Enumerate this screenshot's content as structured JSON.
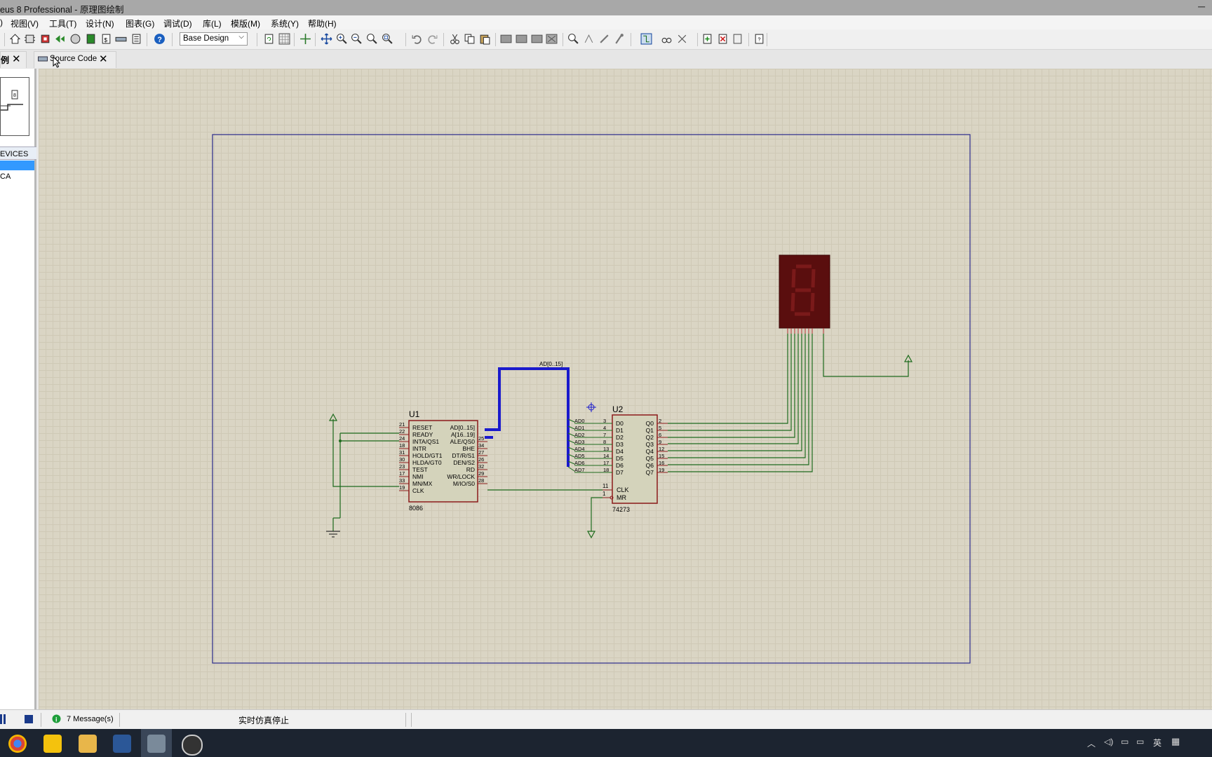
{
  "window": {
    "title": "eus 8 Professional - 原理图绘制"
  },
  "menu": {
    "items": [
      "视图(V)",
      "工具(T)",
      "设计(N)",
      "图表(G)",
      "调试(D)",
      "库(L)",
      "模版(M)",
      "系统(Y)",
      "帮助(H)"
    ]
  },
  "toolbar": {
    "design_select": "Base Design"
  },
  "tabs": {
    "first_label": "例",
    "second_label": "Source Code"
  },
  "left_panel": {
    "devices_header": "EVICES",
    "device_item": "CA"
  },
  "schematic": {
    "u1": {
      "ref": "U1",
      "part": "8086",
      "left_pins": [
        {
          "num": "21",
          "name": "RESET"
        },
        {
          "num": "22",
          "name": "READY"
        },
        {
          "num": "24",
          "name": "INTA/QS1"
        },
        {
          "num": "18",
          "name": "INTR"
        },
        {
          "num": "31",
          "name": "HOLD/GT1"
        },
        {
          "num": "30",
          "name": "HLDA/GT0"
        },
        {
          "num": "23",
          "name": "TEST"
        },
        {
          "num": "17",
          "name": "NMI"
        },
        {
          "num": "33",
          "name": "MN/MX"
        },
        {
          "num": "19",
          "name": "CLK"
        }
      ],
      "right_pins": [
        {
          "num": "",
          "name": "AD[0..15]"
        },
        {
          "num": "",
          "name": "A[16..19]"
        },
        {
          "num": "25",
          "name": "ALE/QS0"
        },
        {
          "num": "34",
          "name": "BHE"
        },
        {
          "num": "27",
          "name": "DT/R/S1"
        },
        {
          "num": "26",
          "name": "DEN/S2"
        },
        {
          "num": "32",
          "name": "RD"
        },
        {
          "num": "29",
          "name": "WR/LOCK"
        },
        {
          "num": "28",
          "name": "M/IO/S0"
        }
      ]
    },
    "u2": {
      "ref": "U2",
      "part": "74273",
      "d_pins": [
        {
          "num": "3",
          "name": "D0",
          "net": "AD0"
        },
        {
          "num": "4",
          "name": "D1",
          "net": "AD1"
        },
        {
          "num": "7",
          "name": "D2",
          "net": "AD2"
        },
        {
          "num": "8",
          "name": "D3",
          "net": "AD3"
        },
        {
          "num": "13",
          "name": "D4",
          "net": "AD4"
        },
        {
          "num": "14",
          "name": "D5",
          "net": "AD5"
        },
        {
          "num": "17",
          "name": "D6",
          "net": "AD6"
        },
        {
          "num": "18",
          "name": "D7",
          "net": "AD7"
        }
      ],
      "q_pins": [
        {
          "num": "2",
          "name": "Q0"
        },
        {
          "num": "5",
          "name": "Q1"
        },
        {
          "num": "6",
          "name": "Q2"
        },
        {
          "num": "9",
          "name": "Q3"
        },
        {
          "num": "12",
          "name": "Q4"
        },
        {
          "num": "15",
          "name": "Q5"
        },
        {
          "num": "16",
          "name": "Q6"
        },
        {
          "num": "19",
          "name": "Q7"
        }
      ],
      "clk_pin": {
        "num": "11",
        "name": "CLK"
      },
      "mr_pin": {
        "num": "1",
        "name": "MR"
      }
    },
    "bus_label": "AD[0..15]"
  },
  "status": {
    "messages": "7 Message(s)",
    "sim_status": "实时仿真停止"
  },
  "colors": {
    "component_fill": "#d4d3bb",
    "component_border": "#8b1a1a",
    "wire": "#1d6b1d",
    "bus": "#1a1acc",
    "frame": "#2a2a8a",
    "display": "#5a0e0e"
  }
}
